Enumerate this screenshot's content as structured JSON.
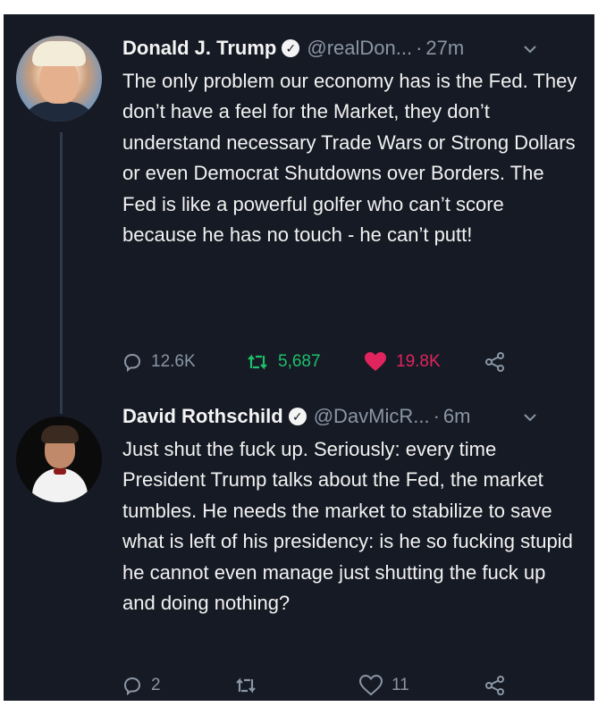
{
  "tweets": [
    {
      "author_name": "Donald J. Trump",
      "handle": "@realDon...",
      "separator": "·",
      "time": "27m",
      "text": "The only problem our economy has is the Fed. They don’t have a feel for the Market, they don’t understand necessary Trade Wars or Strong Dollars or even Democrat Shutdowns over Borders. The Fed is like a powerful golfer who can’t score because he has no touch - he can’t putt!",
      "replies": "12.6K",
      "retweets": "5,687",
      "likes": "19.8K",
      "liked": true,
      "retweeted": true,
      "colors": {
        "retweet": "#1fbf6b",
        "like": "#e0245e",
        "reply": "#8a96a6"
      }
    },
    {
      "author_name": "David Rothschild",
      "handle": "@DavMicR...",
      "separator": "·",
      "time": "6m",
      "text": "Just shut the fuck up. Seriously: every time President Trump talks about the Fed, the market tumbles. He needs the market to stabilize to save what is left of his presidency: is he so fucking stupid he cannot even manage just shutting the fuck up and doing nothing?",
      "replies": "2",
      "retweets": "",
      "likes": "11",
      "liked": false,
      "retweeted": false
    }
  ],
  "icons": [
    "reply-icon",
    "retweet-icon",
    "like-icon",
    "share-icon",
    "verified-badge-icon",
    "chevron-down-icon"
  ],
  "theme": {
    "background": "#161a24",
    "text": "#f2f2f2",
    "muted": "#8a96a6",
    "thread_line": "#2c3a4b"
  }
}
